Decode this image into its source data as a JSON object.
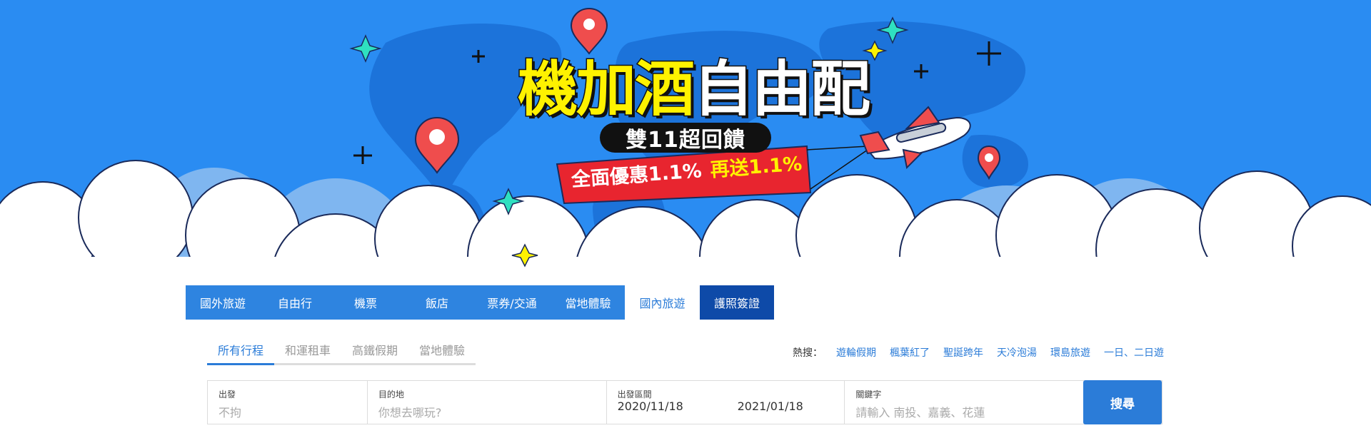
{
  "banner": {
    "title_yellow": "機加酒",
    "title_white": "自由配",
    "subtitle": "雙11超回饋",
    "ribbon_main": "全面優惠1.1%",
    "ribbon_extra": "再送1.1%",
    "colors": {
      "sky": "#2a8cf2",
      "map": "#1a6fd6",
      "title_yellow": "#fff200",
      "ribbon": "#e8252f"
    }
  },
  "tabs": [
    {
      "label": "國外旅遊"
    },
    {
      "label": "自由行"
    },
    {
      "label": "機票"
    },
    {
      "label": "飯店"
    },
    {
      "label": "票券/交通"
    },
    {
      "label": "當地體驗"
    },
    {
      "label": "國內旅遊",
      "active": true
    },
    {
      "label": "護照簽證"
    }
  ],
  "subtabs": [
    {
      "label": "所有行程",
      "active": true
    },
    {
      "label": "和運租車"
    },
    {
      "label": "高鐵假期"
    },
    {
      "label": "當地體驗"
    }
  ],
  "hot": {
    "label": "熱搜：",
    "keywords": [
      "遊輪假期",
      "楓葉紅了",
      "聖誕跨年",
      "天冷泡湯",
      "環島旅遊",
      "一日、二日遊"
    ]
  },
  "search": {
    "depart_label": "出發",
    "depart_value": "不拘",
    "dest_label": "目的地",
    "dest_placeholder": "你想去哪玩?",
    "date_label": "出發區間",
    "date_start": "2020/11/18",
    "date_end": "2021/01/18",
    "keyword_label": "關鍵字",
    "keyword_placeholder": "請輸入 南投、嘉義、花蓮",
    "button": "搜尋"
  }
}
